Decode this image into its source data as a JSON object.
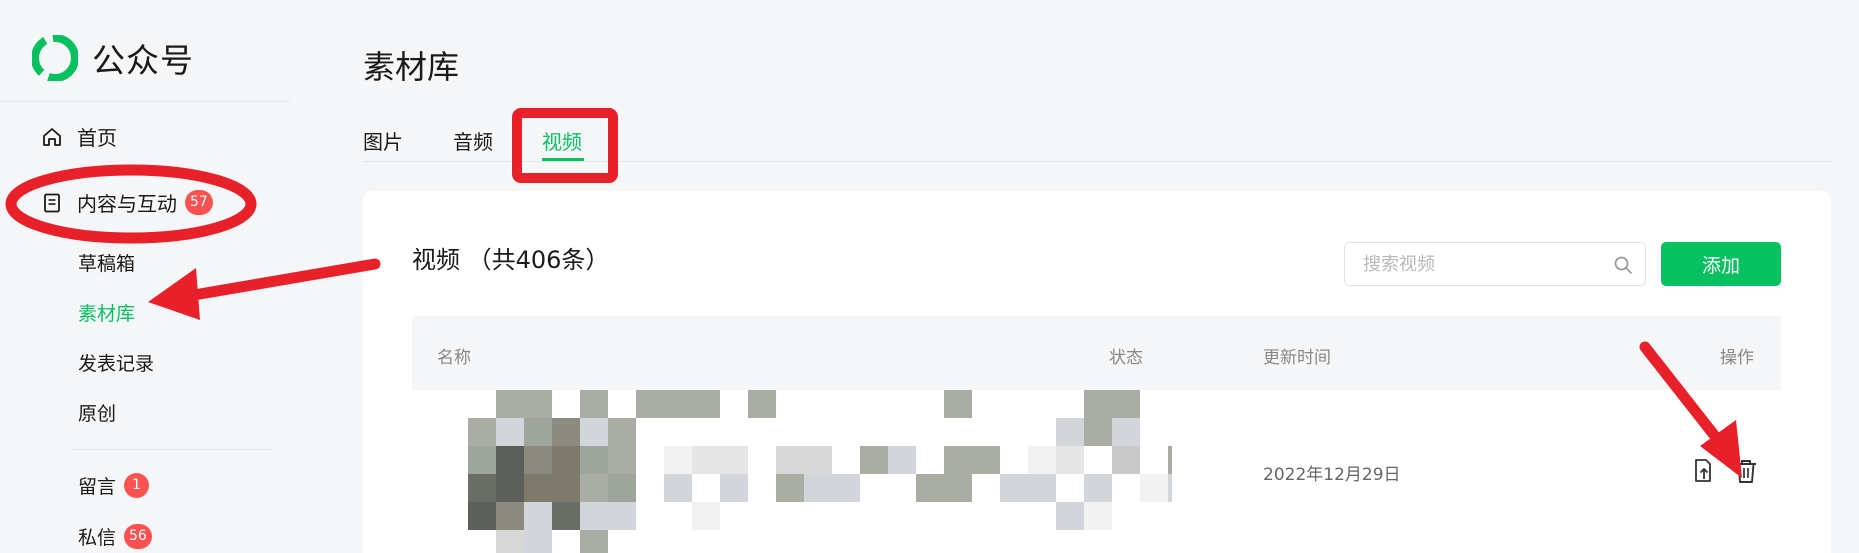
{
  "app": {
    "name": "公众号"
  },
  "sidebar": {
    "home_label": "首页",
    "content_group": {
      "label": "内容与互动",
      "badge": "57"
    },
    "sub_items": [
      {
        "label": "草稿箱"
      },
      {
        "label": "素材库",
        "active": true
      },
      {
        "label": "发表记录"
      },
      {
        "label": "原创"
      }
    ],
    "messages": [
      {
        "label": "留言",
        "badge": "1"
      },
      {
        "label": "私信",
        "badge": "56"
      }
    ]
  },
  "main": {
    "title": "素材库",
    "tabs": [
      {
        "label": "图片"
      },
      {
        "label": "音频"
      },
      {
        "label": "视频",
        "active": true
      }
    ],
    "section_title": "视频 （共406条）",
    "search": {
      "placeholder": "搜索视频"
    },
    "add_label": "添加",
    "table": {
      "columns": [
        "名称",
        "状态",
        "更新时间",
        "操作"
      ],
      "rows": [
        {
          "name": "",
          "status": "",
          "updated": "2022年12月29日",
          "actions": [
            "upload-doc-icon",
            "trash-icon"
          ]
        }
      ]
    }
  },
  "colors": {
    "accent": "#07c160",
    "badge": "#fa5151",
    "annotation": "#e8202a"
  }
}
